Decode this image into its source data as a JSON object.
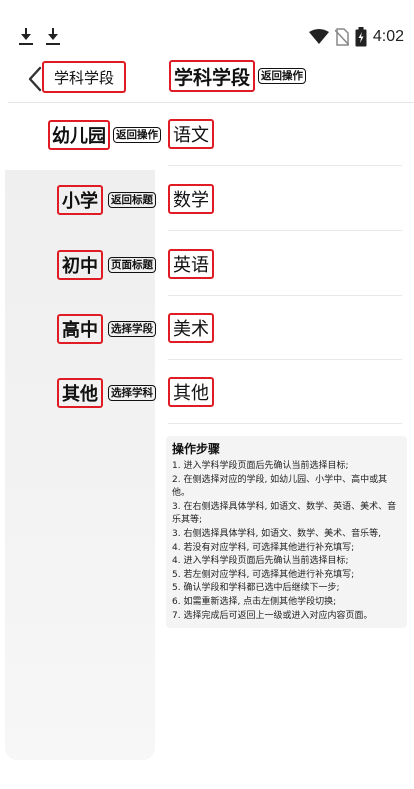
{
  "status": {
    "time": "4:02"
  },
  "topbar": {
    "nav_title": "学科学段",
    "header_title": "学科学段",
    "header_tag": "返回操作"
  },
  "rows": [
    {
      "level": "幼儿园",
      "tag": "返回操作",
      "subject": "语文"
    },
    {
      "level": "小学",
      "tag": "返回标题",
      "subject": "数学"
    },
    {
      "level": "初中",
      "tag": "页面标题",
      "subject": "英语"
    },
    {
      "level": "高中",
      "tag": "选择学段",
      "subject": "美术"
    },
    {
      "level": "其他",
      "tag": "选择学科",
      "subject": "其他"
    }
  ],
  "steps": {
    "title": "操作步骤",
    "items": [
      "1. 进入学科学段页面后先确认当前选择目标;",
      "2. 在侧选择对应的学段, 如幼儿园、小学中、高中或其他。",
      "3. 在右侧选择具体学科, 如语文、数学、英语、美术、音乐其等;",
      "3. 右侧选择具体学科, 如语文、数学、美术、音乐等,",
      "4. 若没有对应学科, 可选择其他进行补充填写;",
      "4. 进入学科学段页面后先确认当前选择目标;",
      "5. 若左侧对应学科, 可选择其他进行补充填写;",
      "5. 确认学段和学科都已选中后继续下一步;",
      "6. 如需重新选择, 点击左侧其他学段切换;",
      "7. 选择完成后可返回上一级或进入对应内容页面。"
    ]
  }
}
